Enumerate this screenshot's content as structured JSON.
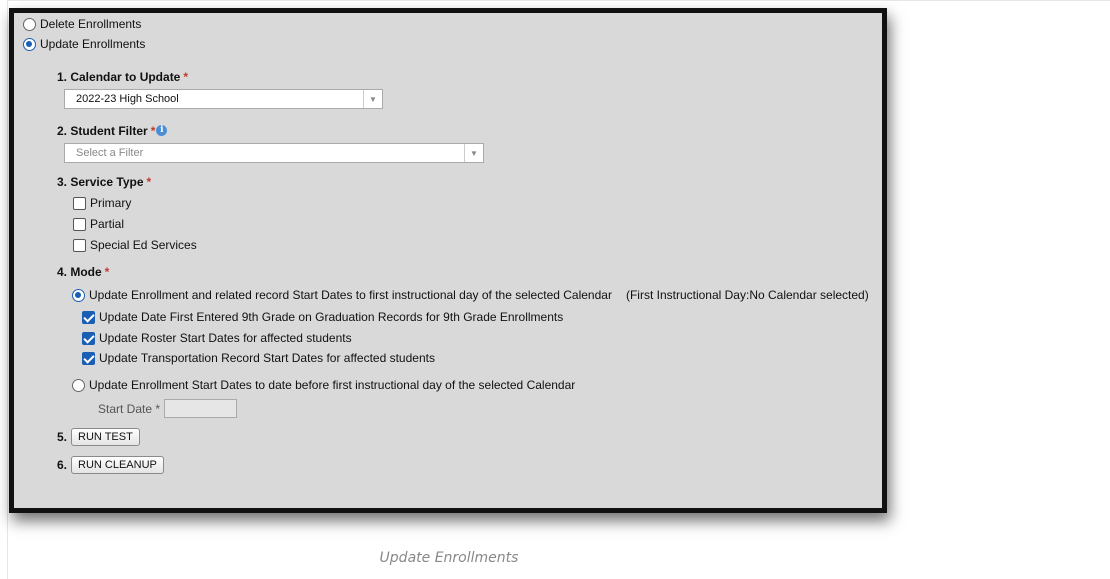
{
  "top_options": {
    "delete_label": "Delete Enrollments",
    "update_label": "Update Enrollments"
  },
  "calendar": {
    "heading": "1. Calendar to Update",
    "required": "*",
    "selected": "2022-23 High School"
  },
  "student_filter": {
    "heading": "2. Student Filter",
    "required": "*",
    "placeholder": "Select a Filter",
    "info_icon": "info-icon"
  },
  "service_type": {
    "heading": "3. Service Type",
    "required": "*",
    "options": [
      {
        "label": "Primary",
        "checked": false
      },
      {
        "label": "Partial",
        "checked": false
      },
      {
        "label": "Special Ed Services",
        "checked": false
      }
    ]
  },
  "mode": {
    "heading": "4. Mode",
    "required": "*",
    "option1_label": "Update Enrollment and related record Start Dates to first instructional day of the selected Calendar",
    "option1_note": "(First Instructional Day:No Calendar selected)",
    "sub_options": [
      {
        "label": "Update Date First Entered 9th Grade on Graduation Records for 9th Grade Enrollments",
        "checked": true
      },
      {
        "label": "Update Roster Start Dates for affected students",
        "checked": true
      },
      {
        "label": "Update Transportation Record Start Dates for affected students",
        "checked": true
      }
    ],
    "option2_label": "Update Enrollment Start Dates to date before first instructional day of the selected Calendar",
    "start_date_label": "Start Date",
    "start_date_required": "*",
    "start_date_value": ""
  },
  "actions": {
    "test_num": "5.",
    "test_label": "RUN TEST",
    "cleanup_num": "6.",
    "cleanup_label": "RUN CLEANUP"
  },
  "caption": "Update Enrollments",
  "colors": {
    "accent": "#1a5fb4",
    "required": "#c0392b",
    "panel_bg": "#d9d9d9"
  }
}
